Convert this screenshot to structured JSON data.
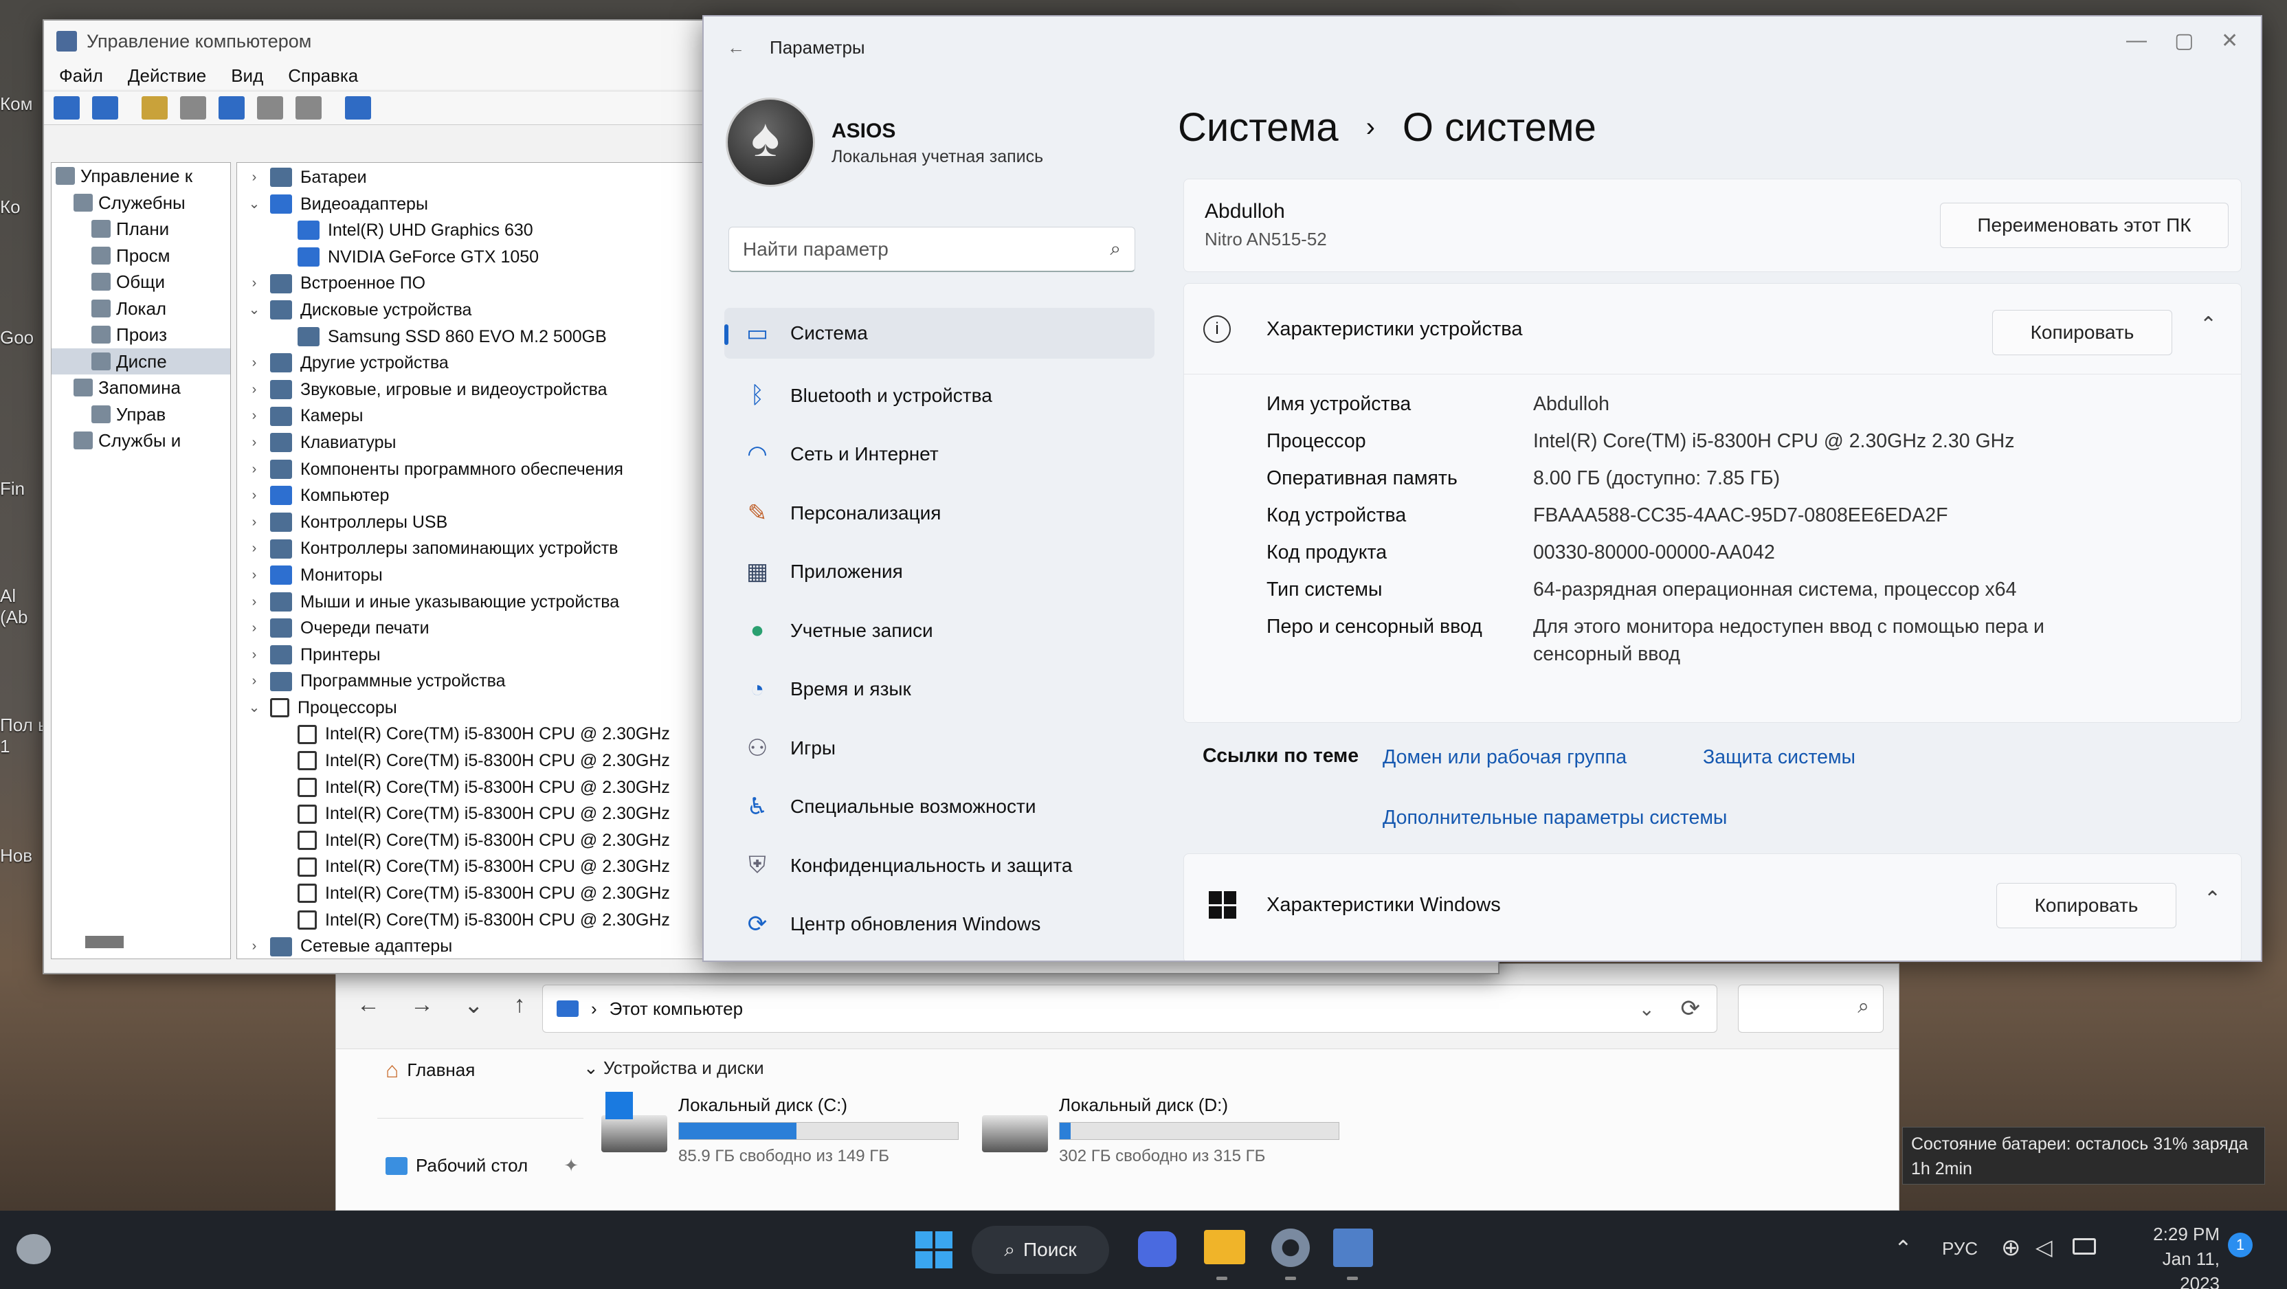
{
  "desktop": {
    "icons": [
      "Ком",
      "Ко",
      "Goo",
      "Fin",
      "Al (Ab",
      "Пол ь 1",
      "Нов"
    ]
  },
  "computer_management": {
    "title": "Управление компьютером",
    "menu": [
      "Файл",
      "Действие",
      "Вид",
      "Справка"
    ],
    "left_tree": [
      {
        "label": "Управление к",
        "indent": 0
      },
      {
        "label": "Служебны",
        "indent": 1
      },
      {
        "label": "Плани",
        "indent": 2
      },
      {
        "label": "Просм",
        "indent": 2
      },
      {
        "label": "Общи",
        "indent": 2
      },
      {
        "label": "Локал",
        "indent": 2
      },
      {
        "label": "Произ",
        "indent": 2
      },
      {
        "label": "Диспе",
        "indent": 2
      },
      {
        "label": "Запомина",
        "indent": 1
      },
      {
        "label": "Управ",
        "indent": 2
      },
      {
        "label": "Службы и",
        "indent": 1
      }
    ],
    "device_tree": [
      {
        "label": "Батареи",
        "chev": "›",
        "level": 0,
        "icon": "battery"
      },
      {
        "label": "Видеоадаптеры",
        "chev": "⌄",
        "level": 0,
        "icon": "monitor"
      },
      {
        "label": "Intel(R) UHD Graphics 630",
        "chev": "",
        "level": 1,
        "icon": "monitor"
      },
      {
        "label": "NVIDIA GeForce GTX 1050",
        "chev": "",
        "level": 1,
        "icon": "monitor"
      },
      {
        "label": "Встроенное ПО",
        "chev": "›",
        "level": 0,
        "icon": "firmware"
      },
      {
        "label": "Дисковые устройства",
        "chev": "⌄",
        "level": 0,
        "icon": "disk"
      },
      {
        "label": "Samsung SSD 860 EVO M.2 500GB",
        "chev": "",
        "level": 1,
        "icon": "disk"
      },
      {
        "label": "Другие устройства",
        "chev": "›",
        "level": 0,
        "icon": "other"
      },
      {
        "label": "Звуковые, игровые и видеоустройства",
        "chev": "›",
        "level": 0,
        "icon": "sound"
      },
      {
        "label": "Камеры",
        "chev": "›",
        "level": 0,
        "icon": "camera"
      },
      {
        "label": "Клавиатуры",
        "chev": "›",
        "level": 0,
        "icon": "keyboard"
      },
      {
        "label": "Компоненты программного обеспечения",
        "chev": "›",
        "level": 0,
        "icon": "software"
      },
      {
        "label": "Компьютер",
        "chev": "›",
        "level": 0,
        "icon": "monitor"
      },
      {
        "label": "Контроллеры USB",
        "chev": "›",
        "level": 0,
        "icon": "usb"
      },
      {
        "label": "Контроллеры запоминающих устройств",
        "chev": "›",
        "level": 0,
        "icon": "storage"
      },
      {
        "label": "Мониторы",
        "chev": "›",
        "level": 0,
        "icon": "monitor"
      },
      {
        "label": "Мыши и иные указывающие устройства",
        "chev": "›",
        "level": 0,
        "icon": "mouse"
      },
      {
        "label": "Очереди печати",
        "chev": "›",
        "level": 0,
        "icon": "printer"
      },
      {
        "label": "Принтеры",
        "chev": "›",
        "level": 0,
        "icon": "printer"
      },
      {
        "label": "Программные устройства",
        "chev": "›",
        "level": 0,
        "icon": "software"
      },
      {
        "label": "Процессоры",
        "chev": "⌄",
        "level": 0,
        "icon": "cpu"
      },
      {
        "label": "Intel(R) Core(TM) i5-8300H CPU @ 2.30GHz",
        "chev": "",
        "level": 1,
        "icon": "cpu"
      },
      {
        "label": "Intel(R) Core(TM) i5-8300H CPU @ 2.30GHz",
        "chev": "",
        "level": 1,
        "icon": "cpu"
      },
      {
        "label": "Intel(R) Core(TM) i5-8300H CPU @ 2.30GHz",
        "chev": "",
        "level": 1,
        "icon": "cpu"
      },
      {
        "label": "Intel(R) Core(TM) i5-8300H CPU @ 2.30GHz",
        "chev": "",
        "level": 1,
        "icon": "cpu"
      },
      {
        "label": "Intel(R) Core(TM) i5-8300H CPU @ 2.30GHz",
        "chev": "",
        "level": 1,
        "icon": "cpu"
      },
      {
        "label": "Intel(R) Core(TM) i5-8300H CPU @ 2.30GHz",
        "chev": "",
        "level": 1,
        "icon": "cpu"
      },
      {
        "label": "Intel(R) Core(TM) i5-8300H CPU @ 2.30GHz",
        "chev": "",
        "level": 1,
        "icon": "cpu"
      },
      {
        "label": "Intel(R) Core(TM) i5-8300H CPU @ 2.30GHz",
        "chev": "",
        "level": 1,
        "icon": "cpu"
      },
      {
        "label": "Сетевые адаптеры",
        "chev": "›",
        "level": 0,
        "icon": "network"
      }
    ]
  },
  "settings": {
    "title": "Параметры",
    "back": "←",
    "user": {
      "name": "ASIOS",
      "type": "Локальная учетная запись"
    },
    "search_placeholder": "Найти параметр",
    "nav": [
      {
        "label": "Система",
        "icon": "system-icon",
        "glyph": "▭",
        "color": "#1a64c8",
        "selected": true
      },
      {
        "label": "Bluetooth и устройства",
        "icon": "bluetooth-icon",
        "glyph": "ᛒ",
        "color": "#1a64c8"
      },
      {
        "label": "Сеть и Интернет",
        "icon": "wifi-icon",
        "glyph": "◠",
        "color": "#1a64c8"
      },
      {
        "label": "Персонализация",
        "icon": "brush-icon",
        "glyph": "✎",
        "color": "#c0602a"
      },
      {
        "label": "Приложения",
        "icon": "apps-icon",
        "glyph": "▦",
        "color": "#3a4a66"
      },
      {
        "label": "Учетные записи",
        "icon": "account-icon",
        "glyph": "●",
        "color": "#2aa070"
      },
      {
        "label": "Время и язык",
        "icon": "globe-clock-icon",
        "glyph": "◔",
        "color": "#1a64c8"
      },
      {
        "label": "Игры",
        "icon": "gamepad-icon",
        "glyph": "⚇",
        "color": "#667"
      },
      {
        "label": "Специальные возможности",
        "icon": "accessibility-icon",
        "glyph": "♿",
        "color": "#1a64c8"
      },
      {
        "label": "Конфиденциальность и защита",
        "icon": "shield-icon",
        "glyph": "⛨",
        "color": "#667"
      },
      {
        "label": "Центр обновления Windows",
        "icon": "update-icon",
        "glyph": "⟳",
        "color": "#1a64c8"
      }
    ],
    "breadcrumb": {
      "parent": "Система",
      "sep": "›",
      "current": "О системе"
    },
    "device": {
      "name": "Abdulloh",
      "model": "Nitro AN515-52",
      "rename_label": "Переименовать этот ПК"
    },
    "specs_header": "Характеристики устройства",
    "copy_label": "Копировать",
    "specs": [
      {
        "k": "Имя устройства",
        "v": "Abdulloh"
      },
      {
        "k": "Процессор",
        "v": "Intel(R) Core(TM) i5-8300H CPU @ 2.30GHz   2.30 GHz"
      },
      {
        "k": "Оперативная память",
        "v": "8.00 ГБ (доступно: 7.85 ГБ)"
      },
      {
        "k": "Код устройства",
        "v": "FBAAA588-CC35-4AAC-95D7-0808EE6EDA2F"
      },
      {
        "k": "Код продукта",
        "v": "00330-80000-00000-AA042"
      },
      {
        "k": "Тип системы",
        "v": "64-разрядная операционная система, процессор x64"
      },
      {
        "k": "Перо и сенсорный ввод",
        "v": "Для этого монитора недоступен ввод с помощью пера и сенсорный ввод"
      }
    ],
    "related": {
      "label": "Ссылки по теме",
      "links": [
        "Домен или рабочая группа",
        "Защита системы",
        "Дополнительные параметры системы"
      ]
    },
    "windows_header": "Характеристики Windows"
  },
  "explorer": {
    "address": "Этот компьютер",
    "sidebar": [
      "Главная",
      "Рабочий стол"
    ],
    "group": "Устройства и диски",
    "drives": [
      {
        "name": "Локальный диск (C:)",
        "free": "85.9 ГБ свободно из 149 ГБ",
        "used_fraction": 0.42
      },
      {
        "name": "Локальный диск (D:)",
        "free": "302 ГБ свободно из 315 ГБ",
        "used_fraction": 0.04
      }
    ]
  },
  "battery_tooltip": {
    "line1": "Состояние батареи: осталось 31% заряда",
    "line2": "1h 2min"
  },
  "taskbar": {
    "search_label": "Поиск",
    "lang": "РУС",
    "time": "2:29 PM",
    "date": "Jan 11, 2023",
    "notifications": "1"
  }
}
